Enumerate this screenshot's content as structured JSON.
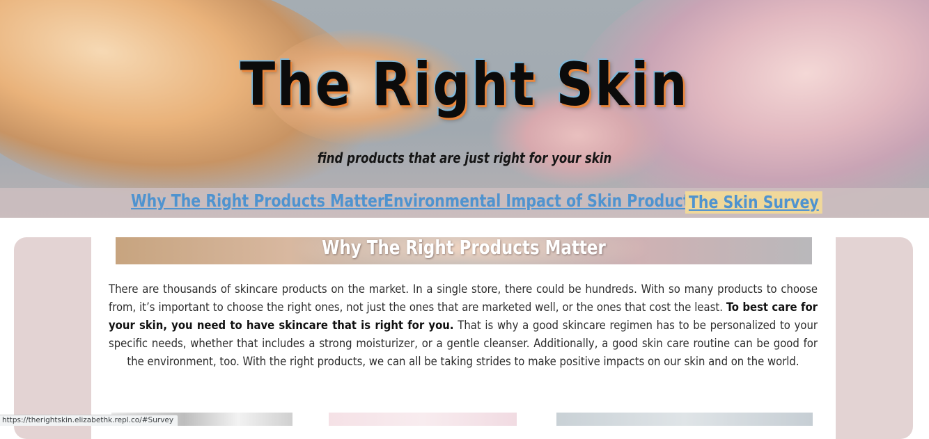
{
  "site": {
    "title": "The Right Skin",
    "tagline": "find products that are just right for your skin"
  },
  "nav": {
    "items": [
      {
        "label": "Why The Right Products Matter",
        "href": "#Why"
      },
      {
        "label": "Environmental Impact of Skin Products",
        "href": "#Environment"
      },
      {
        "label": "The Skin Survey",
        "href": "#Survey",
        "highlighted": true
      }
    ]
  },
  "section": {
    "title": "Why The Right Products Matter",
    "paragraph": {
      "before": "There are thousands of skincare products on the market. In a single store, there could be hundreds. With so many products to choose from, it’s important to choose the right ones, not just the ones that are marketed well, or the ones that cost the least. ",
      "bold": "To best care for your skin, you need to have skincare that is right for you.",
      "after": " That is why a good skincare regimen has to be personalized to your specific needs, whether that includes a strong moisturizer, or a gentle cleanser. Additionally, a good skin care routine can be good for the environment, too. With the right products, we can all be taking strides to make positive impacts on our skin and on the world."
    }
  },
  "status_bar": {
    "url": "https://therightskin.elizabethk.repl.co/#Survey"
  },
  "colors": {
    "nav_link": "#4f93cf",
    "nav_highlight": "#f0d89a",
    "panel": "#e3d3d3",
    "title_outline": "#e9873d"
  }
}
